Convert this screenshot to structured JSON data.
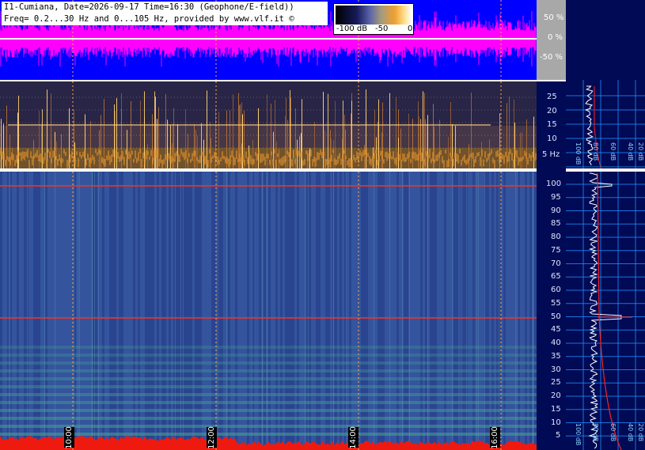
{
  "header": {
    "line1": "I1-Cumiana, Date=2026-09-17 Time=16:30 (Geophone/E-field))",
    "line2": "Freq= 0.2...30 Hz and 0...105 Hz, provided by www.vlf.it ©"
  },
  "colorbar": {
    "labels": [
      "-100 dB",
      "-50",
      "0"
    ]
  },
  "waveform_axis": {
    "labels": [
      "50 %",
      "0 %",
      "-50 %"
    ]
  },
  "low_freq_axis": {
    "labels": [
      "25",
      "20",
      "15",
      "10",
      "5 Hz"
    ]
  },
  "main_freq_axis": {
    "labels": [
      "100",
      "95",
      "90",
      "85",
      "80",
      "75",
      "70",
      "65",
      "60",
      "55",
      "50",
      "45",
      "40",
      "35",
      "30",
      "25",
      "20",
      "15",
      "10",
      "5"
    ]
  },
  "time_axis": {
    "labels": [
      "10:00",
      "12:00",
      "14:00",
      "16:00"
    ]
  },
  "right_panel": {
    "db_labels": [
      "100 dB",
      "80 dB",
      "60 dB",
      "40 dB",
      "20 dB"
    ]
  },
  "colors": {
    "waveform_bg": "#0000ff",
    "waveform_trace": "#ff00ff",
    "axis_bg": "#000a55",
    "spectrum_bg": "#2d4a97",
    "hum_line": "#ff3020",
    "grid": "#1f8fff",
    "spectrum_curve": "#ffffff",
    "fit_curve": "#ff2020"
  }
}
